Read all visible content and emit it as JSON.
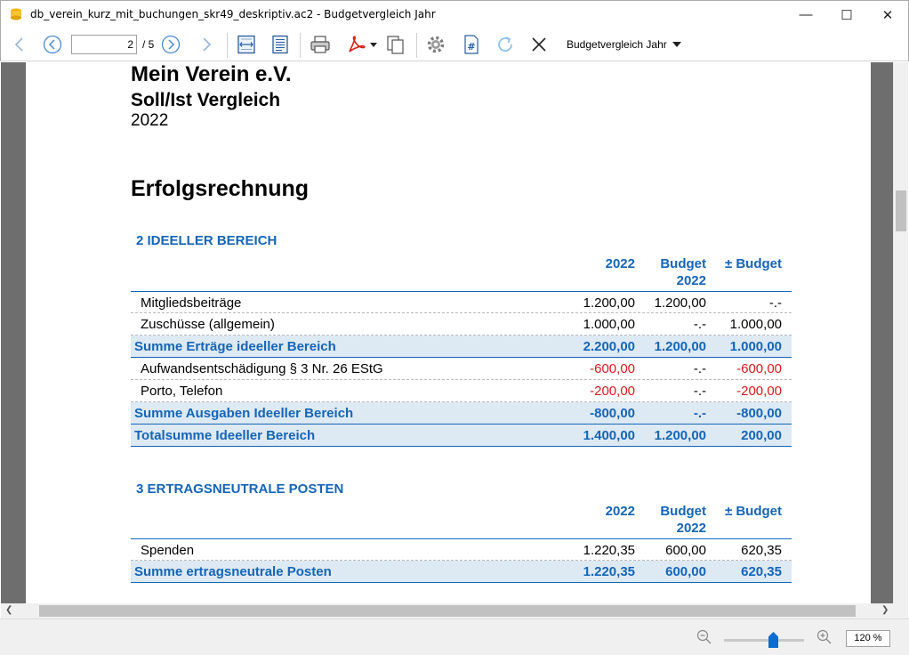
{
  "window": {
    "title": "db_verein_kurz_mit_buchungen_skr49_deskriptiv.ac2 - Budgetvergleich Jahr",
    "minimize": "—",
    "maximize": "☐",
    "close": "✕"
  },
  "toolbar": {
    "page_current": "2",
    "page_total": "/ 5",
    "report_name": "Budgetvergleich Jahr"
  },
  "statusbar": {
    "zoom": "120 %"
  },
  "report": {
    "org": "Mein Verein e.V.",
    "title": "Soll/Ist Vergleich",
    "year": "2022",
    "section": "Erfolgsrechnung",
    "groups": [
      {
        "heading": "2 IDEELLER BEREICH",
        "columns": [
          "2022",
          "Budget 2022",
          "± Budget"
        ],
        "rows": [
          {
            "label": "Mitgliedsbeiträge",
            "v1": "1.200,00",
            "v2": "1.200,00",
            "v3": "-.-",
            "type": "item"
          },
          {
            "label": "Zuschüsse (allgemein)",
            "v1": "1.000,00",
            "v2": "-.-",
            "v3": "1.000,00",
            "type": "item"
          },
          {
            "label": "Summe Erträge ideeller Bereich",
            "v1": "2.200,00",
            "v2": "1.200,00",
            "v3": "1.000,00",
            "type": "sum"
          },
          {
            "label": "Aufwandsentschädigung § 3 Nr. 26 EStG",
            "v1": "-600,00",
            "v2": "-.-",
            "v3": "-600,00",
            "type": "item"
          },
          {
            "label": "Porto, Telefon",
            "v1": "-200,00",
            "v2": "-.-",
            "v3": "-200,00",
            "type": "item"
          },
          {
            "label": "Summe Ausgaben Ideeller Bereich",
            "v1": "-800,00",
            "v2": "-.-",
            "v3": "-800,00",
            "type": "sum"
          },
          {
            "label": "Totalsumme Ideeller Bereich",
            "v1": "1.400,00",
            "v2": "1.200,00",
            "v3": "200,00",
            "type": "sum"
          }
        ]
      },
      {
        "heading": "3 ERTRAGSNEUTRALE POSTEN",
        "columns": [
          "2022",
          "Budget 2022",
          "± Budget"
        ],
        "rows": [
          {
            "label": "Spenden",
            "v1": "1.220,35",
            "v2": "600,00",
            "v3": "620,35",
            "type": "item"
          },
          {
            "label": "Summe ertragsneutrale Posten",
            "v1": "1.220,35",
            "v2": "600,00",
            "v3": "620,35",
            "type": "sum"
          }
        ]
      }
    ]
  },
  "colors": {
    "accent": "#1565b8",
    "negative": "#d9191b",
    "sum_bg": "#dde9f3"
  }
}
